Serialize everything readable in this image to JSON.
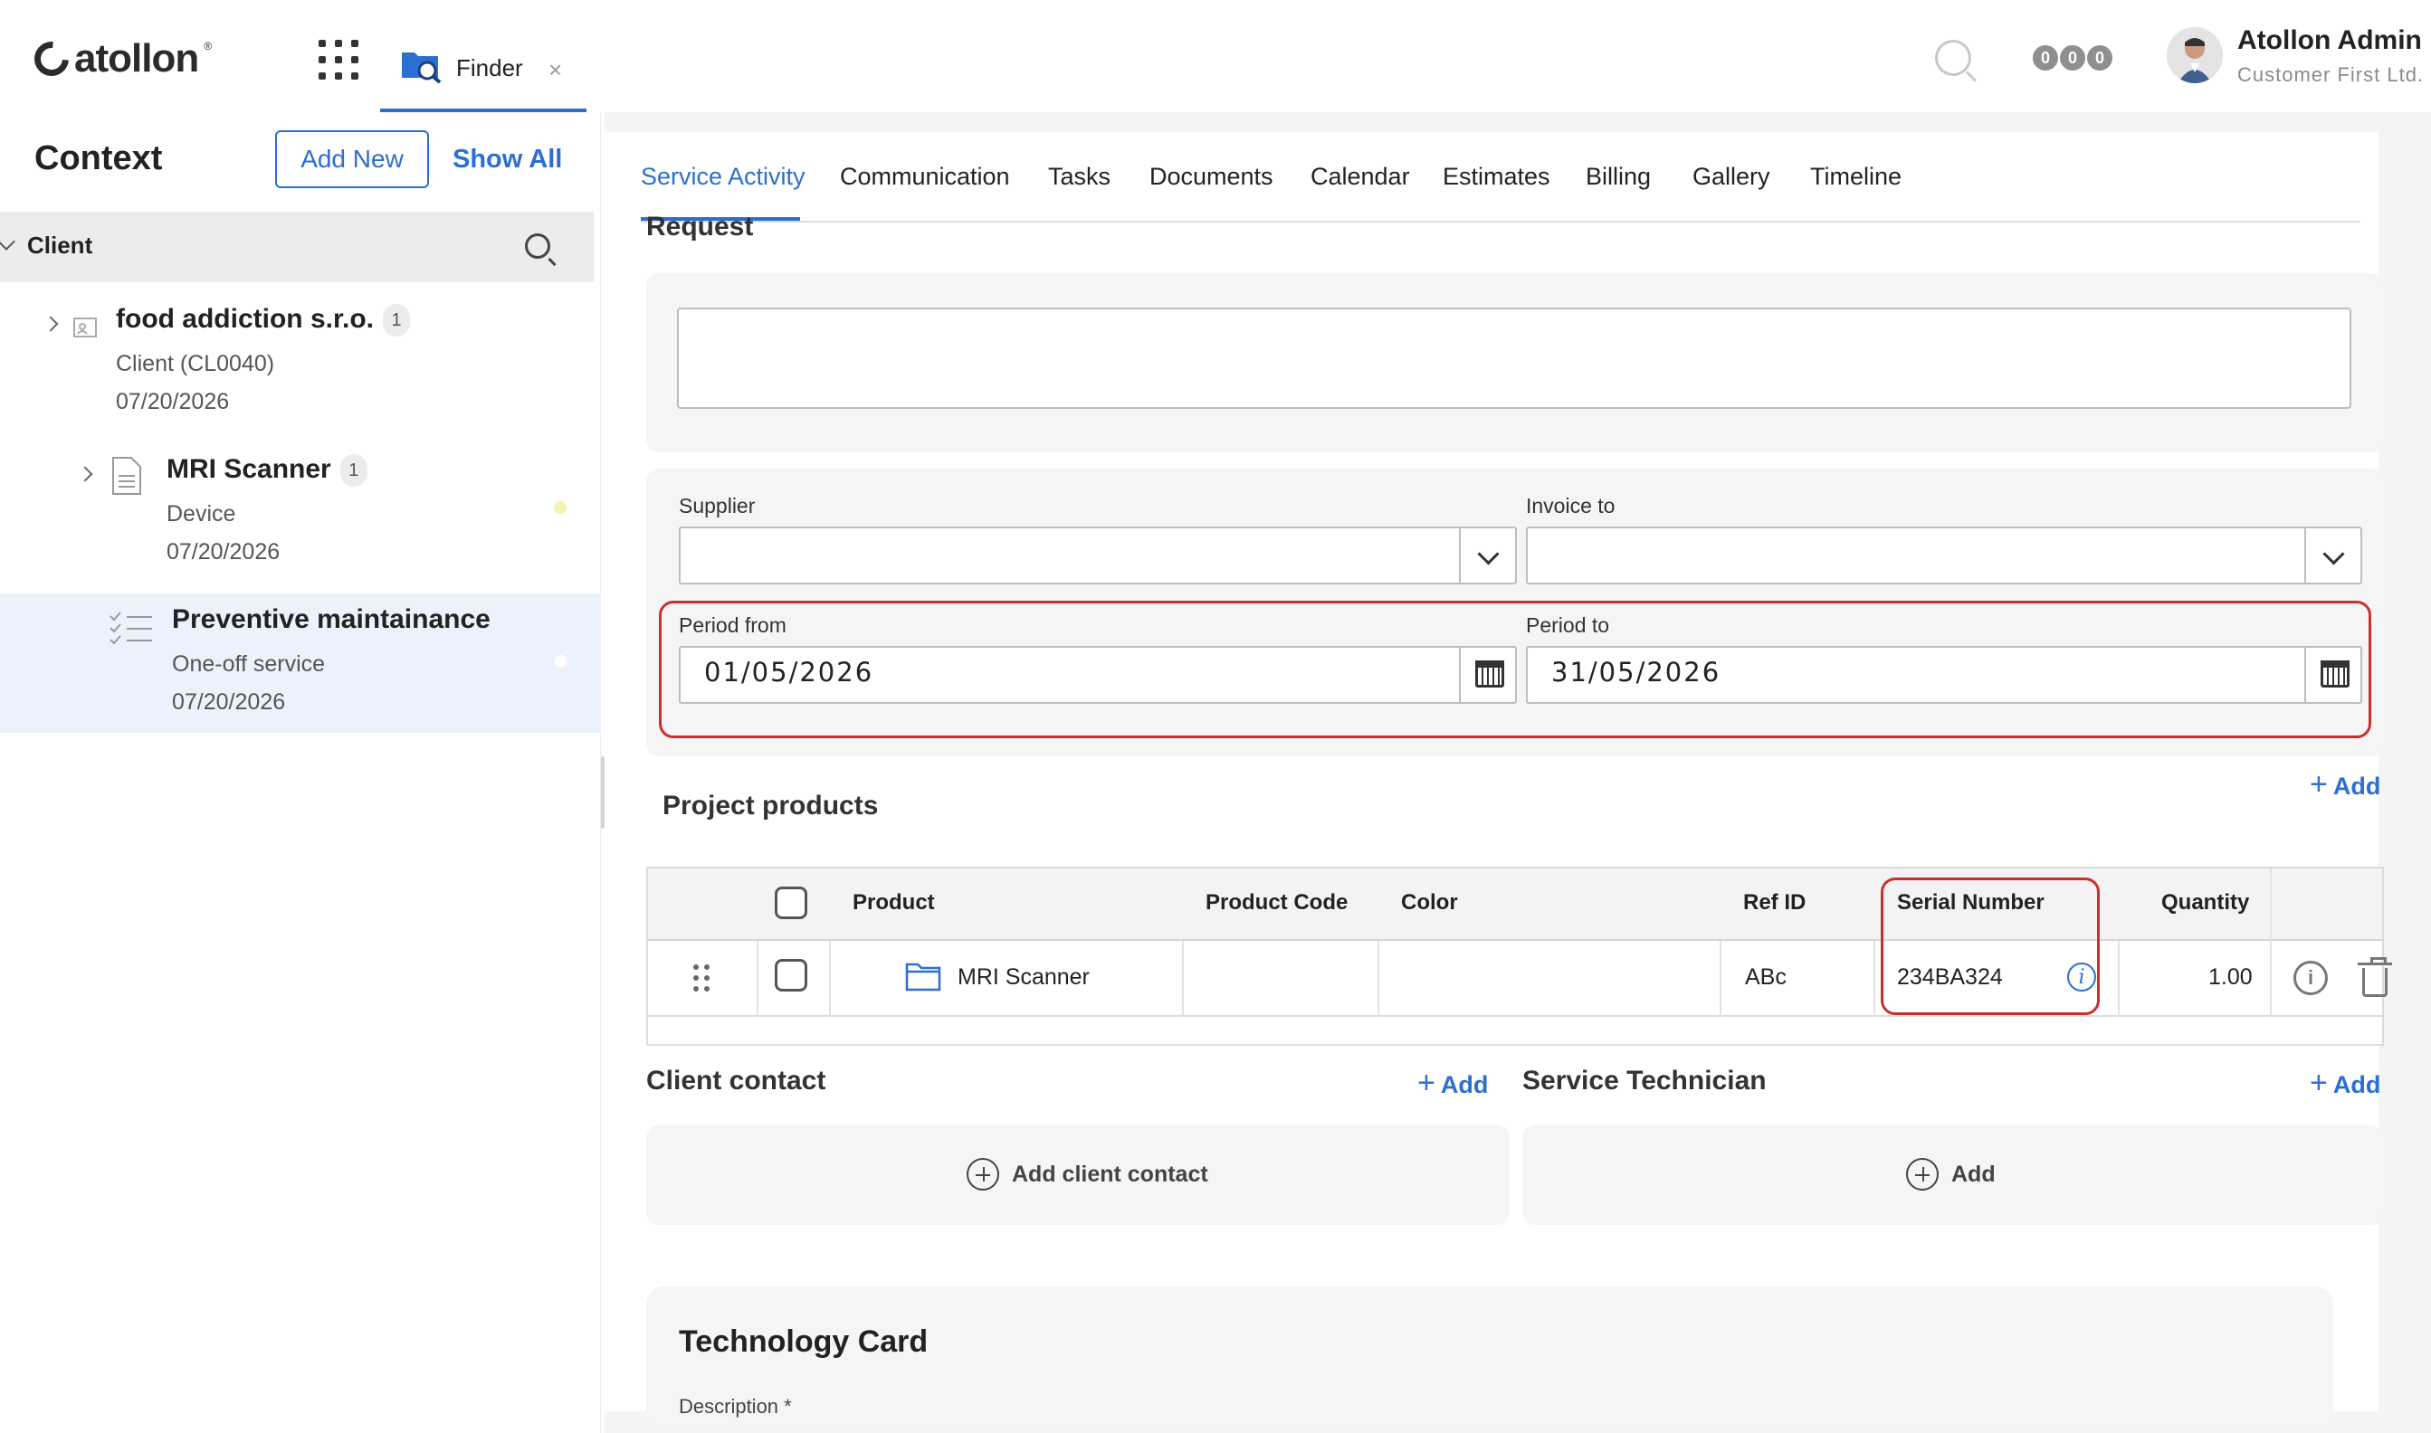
{
  "app": {
    "logo_text": "atollon",
    "logo_reg": "®",
    "finder_tab_label": "Finder",
    "close_glyph": "×"
  },
  "header": {
    "notifications": [
      "0",
      "0",
      "0"
    ],
    "user_name": "Atollon Admin",
    "user_org": "Customer First Ltd."
  },
  "sidebar": {
    "title": "Context",
    "add_new_label": "Add New",
    "show_all_label": "Show All",
    "group_label": "Client",
    "items": [
      {
        "title": "food addiction s.r.o.",
        "badge": "1",
        "subtitle": "Client (CL0040)",
        "date": "07/20/2026"
      },
      {
        "title": "MRI Scanner",
        "badge": "1",
        "subtitle": "Device",
        "date": "07/20/2026"
      },
      {
        "title": "Preventive maintainance",
        "subtitle": "One-off service",
        "date": "07/20/2026"
      }
    ]
  },
  "tabs": [
    {
      "label": "Service Activity",
      "active": true
    },
    {
      "label": "Communication"
    },
    {
      "label": "Tasks"
    },
    {
      "label": "Documents"
    },
    {
      "label": "Calendar"
    },
    {
      "label": "Estimates"
    },
    {
      "label": "Billing"
    },
    {
      "label": "Gallery"
    },
    {
      "label": "Timeline"
    }
  ],
  "form": {
    "request_title": "Request",
    "request_value": "",
    "supplier_label": "Supplier",
    "supplier_value": "",
    "invoice_to_label": "Invoice to",
    "invoice_to_value": "",
    "period_from_label": "Period from",
    "period_from_value": "01/05/2026",
    "period_to_label": "Period to",
    "period_to_value": "31/05/2026"
  },
  "products": {
    "title": "Project products",
    "add_label": "Add",
    "columns": [
      "Product",
      "Product Code",
      "Color",
      "Ref ID",
      "Serial Number",
      "Quantity"
    ],
    "rows": [
      {
        "product": "MRI Scanner",
        "product_code": "",
        "color": "",
        "ref_id": "ABc",
        "serial_number": "234BA324",
        "quantity": "1.00"
      }
    ]
  },
  "client_contact": {
    "title": "Client contact",
    "add_label": "Add",
    "button_label": "Add client contact"
  },
  "service_technician": {
    "title": "Service Technician",
    "add_label": "Add",
    "button_label": "Add"
  },
  "technology_card": {
    "title": "Technology Card",
    "description_label": "Description",
    "required_mark": "*"
  },
  "colors": {
    "accent": "#2c6fd1",
    "highlight": "#c9302c",
    "selected_row": "#ebf2fb"
  }
}
